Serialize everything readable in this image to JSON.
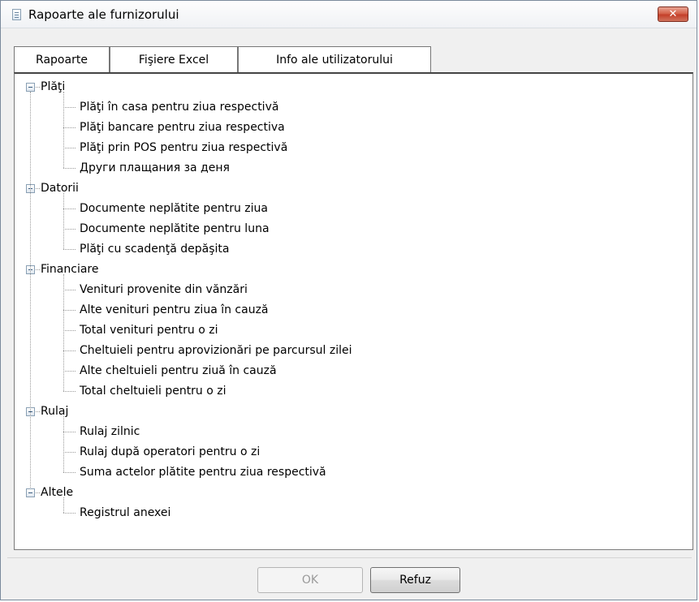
{
  "window": {
    "title": "Rapoarte ale furnizorului",
    "close_label": "✕"
  },
  "tabs": [
    {
      "label": "Rapoarte",
      "active": true
    },
    {
      "label": "Fişiere Excel",
      "active": false
    },
    {
      "label": "Info ale utilizatorului",
      "active": false
    }
  ],
  "tree": [
    {
      "label": "Plăţi",
      "expanded": true,
      "children": [
        "Plăţi în casa pentru ziua respectivă",
        "Plăţi bancare pentru ziua respectiva",
        "Plăţi prin POS pentru ziua respectivă",
        "Други плащания за деня"
      ]
    },
    {
      "label": "Datorii",
      "expanded": true,
      "children": [
        "Documente neplătite pentru ziua",
        "Documente neplătite pentru luna",
        "Plăţi cu scadenţă depăşita"
      ]
    },
    {
      "label": "Financiare",
      "expanded": true,
      "children": [
        "Venituri provenite din vănzări",
        "Alte venituri pentru ziua în cauză",
        "Total venituri pentru o zi",
        "Cheltuieli pentru aprovizionări pe parcursul zilei",
        "Alte cheltuieli pentru ziuă în cauză",
        "Total cheltuieli pentru o zi"
      ]
    },
    {
      "label": "Rulaj",
      "expanded": true,
      "children": [
        "Rulaj zilnic",
        "Rulaj după operatori pentru o zi",
        "Suma actelor plătite pentru ziua respectivă"
      ]
    },
    {
      "label": "Altele",
      "expanded": true,
      "children": [
        "Registrul anexei"
      ]
    }
  ],
  "buttons": {
    "ok_label": "OK",
    "ok_enabled": false,
    "cancel_label": "Refuz"
  }
}
